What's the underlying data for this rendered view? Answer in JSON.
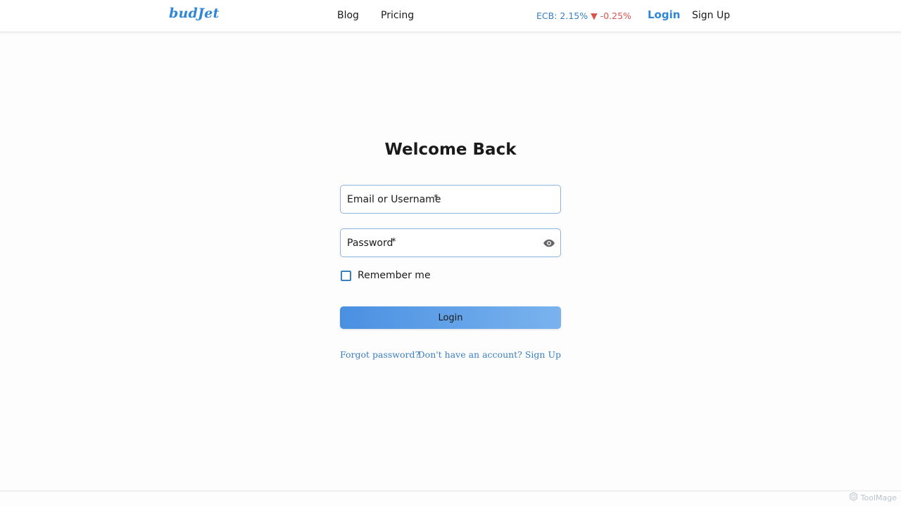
{
  "nav": {
    "logo": "budJet",
    "blog": "Blog",
    "pricing": "Pricing",
    "ecb_label": "ECB: 2.15%",
    "ecb_arrow": "▼",
    "ecb_change": "-0.25%",
    "login": "Login",
    "signup": "Sign Up"
  },
  "form": {
    "title": "Welcome Back",
    "email_placeholder": "Email or Username",
    "email_required": "*",
    "password_placeholder": "Password",
    "password_required": "*",
    "remember_label": "Remember me",
    "login_button": "Login",
    "forgot_link": "Forgot password?",
    "signup_link": "Don't have an account? Sign Up"
  },
  "footer": {
    "watermark": "ToolMage"
  },
  "colors": {
    "accent": "#2f86d6",
    "field_border": "#8ab4dc",
    "negative": "#d9534f"
  },
  "icons": {
    "password_toggle": "eye-icon",
    "watermark": "toolmage-logo-icon"
  }
}
